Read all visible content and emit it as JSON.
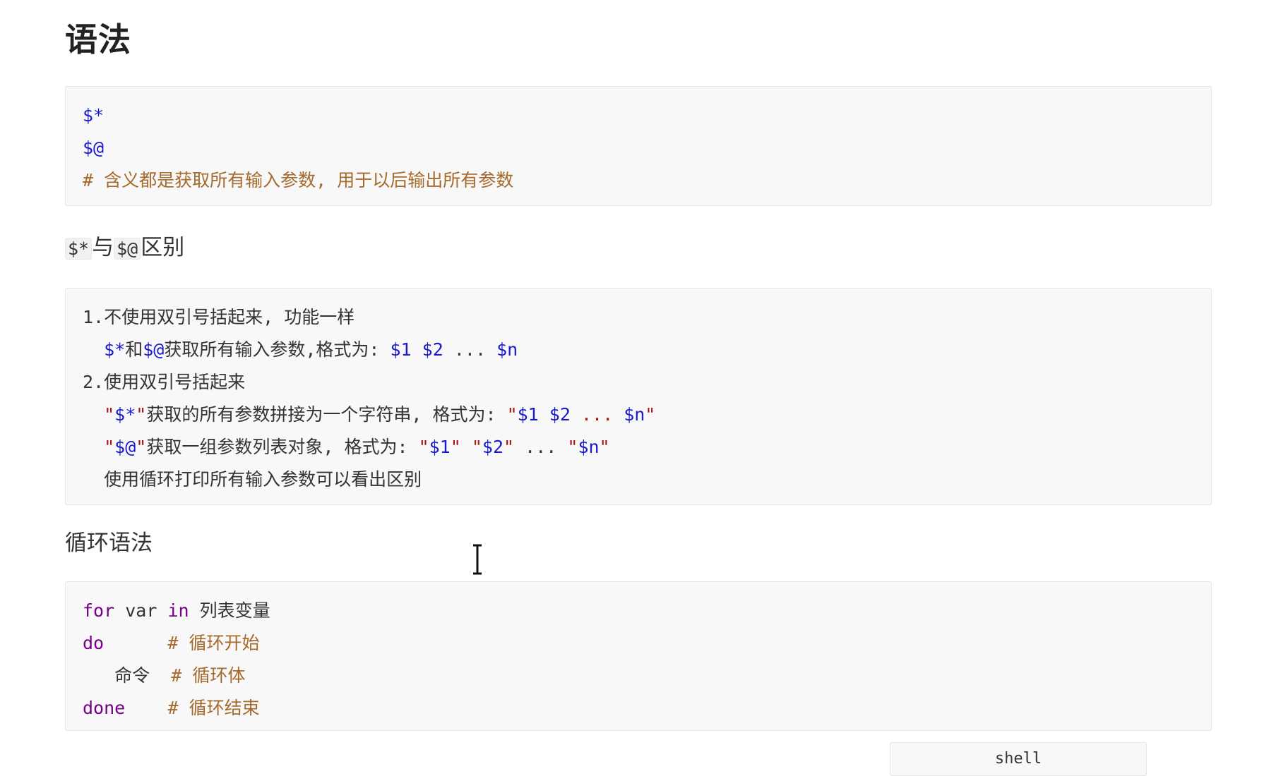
{
  "heading": "语法",
  "block1": {
    "lines": [
      {
        "a": "$*"
      },
      {
        "a": "$@"
      },
      {
        "hash": "#",
        "comment": " 含义都是获取所有输入参数, 用于以后输出所有参数"
      }
    ]
  },
  "section_diff": {
    "code_a": "$*",
    "text_mid": "与",
    "code_b": "$@",
    "text_end": "区别"
  },
  "block2": {
    "l1_num": "1.",
    "l1_text": "不使用双引号括起来, 功能一样",
    "l2_var_a": "$*",
    "l2_and": "和",
    "l2_var_b": "$@",
    "l2_text": "获取所有输入参数,格式为: ",
    "l2_v1": "$1",
    "l2_v2": "$2",
    "l2_dots": "...",
    "l2_vn": "$n",
    "l3_num": "2.",
    "l3_text": "使用双引号括起来",
    "l4_q1": "\"",
    "l4_var": "$*",
    "l4_q2": "\"",
    "l4_text": "获取的所有参数拼接为一个字符串, 格式为: ",
    "l4_q3": "\"",
    "l4_v1": "$1",
    "l4_v2": "$2",
    "l4_dots": "...",
    "l4_vn": "$n",
    "l4_q4": "\"",
    "l5_q1": "\"",
    "l5_var": "$@",
    "l5_q2": "\"",
    "l5_text": "获取一组参数列表对象, 格式为: ",
    "l5_s1q1": "\"",
    "l5_s1": "$1",
    "l5_s1q2": "\"",
    "l5_s2q1": "\"",
    "l5_s2": "$2",
    "l5_s2q2": "\"",
    "l5_dots": "...",
    "l5_snq1": "\"",
    "l5_sn": "$n",
    "l5_snq2": "\"",
    "l6_text": "使用循环打印所有输入参数可以看出区别"
  },
  "section_loop": "循环语法",
  "block3": {
    "l1_kw_for": "for",
    "l1_var": "var",
    "l1_kw_in": "in",
    "l1_text": "列表变量",
    "l2_kw": "do",
    "l2_hash": "#",
    "l2_comment": "循环开始",
    "l3_text": "命令",
    "l3_hash": "#",
    "l3_comment": "循环体",
    "l4_kw": "done",
    "l4_hash": "#",
    "l4_comment": "循环结束"
  },
  "lang_tag": "shell"
}
